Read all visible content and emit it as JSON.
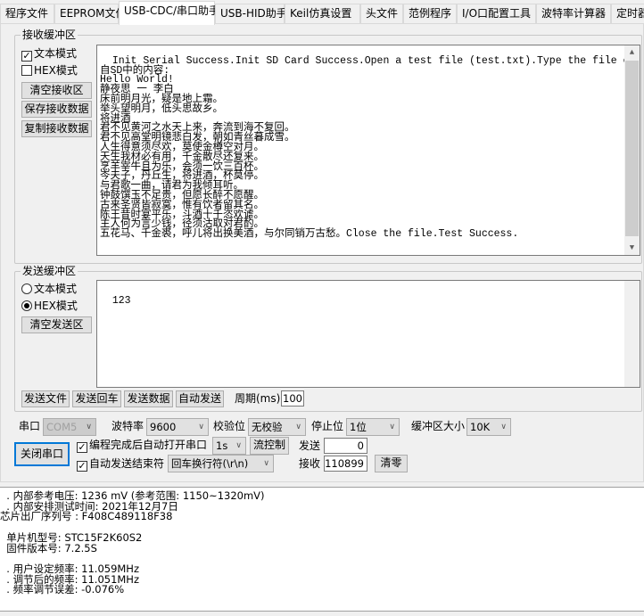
{
  "tabs": [
    "程序文件",
    "EEPROM文件",
    "USB-CDC/串口助手",
    "USB-HID助手",
    "Keil仿真设置",
    "头文件",
    "范例程序",
    "I/O口配置工具",
    "波特率计算器",
    "定时器"
  ],
  "active_tab": "USB-CDC/串口助手",
  "receive": {
    "title": "接收缓冲区",
    "text_mode": {
      "label": "文本模式",
      "checked": true
    },
    "hex_mode": {
      "label": "HEX模式",
      "checked": false
    },
    "buttons": [
      "清空接收区",
      "保存接收数据",
      "复制接收数据"
    ],
    "content": "Init Serial Success.Init SD Card Success.Open a test file (test.txt).Type the file content.这是来\n自SD中的内容:\nHello World!\n静夜思 一 李白\n床前明月光，疑是地上霜。\n举头望明月，低头思故乡。\n将进酒\n君不见黄河之水天上来，奔流到海不复回。\n君不见高堂明镜悲白发，朝如青丝暮成雪。\n人生得意须尽欢，莫使金樽空对月。\n天生我材必有用，千金散尽还复来。\n烹羊宰牛且为乐，会须一饮三百杯。\n岑夫子，丹丘生，将进酒，杯莫停。\n与君歌一曲，请君为我倾耳听。\n钟鼓馔玉不足贵，但愿长醉不愿醒。\n古来圣贤皆寂寞，惟有饮者留其名。\n陈王昔时宴平乐，斗酒十千恣欢谑。\n主人何为言少钱，径须沽取对君酌。\n五花马、千金裘，呼儿将出换美酒，与尔同销万古愁。Close the file.Test Success."
  },
  "send": {
    "title": "发送缓冲区",
    "text_mode": {
      "label": "文本模式",
      "selected": false
    },
    "hex_mode": {
      "label": "HEX模式",
      "selected": true
    },
    "clear_button": "清空发送区",
    "content": "123",
    "buttons": [
      "发送文件",
      "发送回车",
      "发送数据",
      "自动发送"
    ],
    "period_label": "周期(ms)",
    "period_value": "100"
  },
  "serial": {
    "port_label": "串口",
    "port_value": "COM5",
    "baud_label": "波特率",
    "baud_value": "9600",
    "parity_label": "校验位",
    "parity_value": "无校验",
    "stop_label": "停止位",
    "stop_value": "1位",
    "buffer_label": "缓冲区大小",
    "buffer_value": "10K",
    "close_button": "关闭串口",
    "auto_open": {
      "label": "编程完成后自动打开串口",
      "checked": true
    },
    "auto_open_delay": "1s",
    "flow_button": "流控制",
    "auto_end": {
      "label": "自动发送结束符",
      "checked": true
    },
    "end_char": "回车换行符(\\r\\n)",
    "sent_label": "发送",
    "sent_value": "0",
    "recv_label": "接收",
    "recv_value": "110899",
    "clear_button": "清零"
  },
  "log": "  . 内部参考电压: 1236 mV (参考范围: 1150~1320mV)\n  . 内部安排测试时间: 2021年12月7日\n芯片出厂序列号 : F408C489118F38\n\n  单片机型号: STC15F2K60S2\n  固件版本号: 7.2.5S\n\n  . 用户设定频率: 11.059MHz\n  . 调节后的频率: 11.051MHz\n  . 频率调节误差: -0.076%"
}
